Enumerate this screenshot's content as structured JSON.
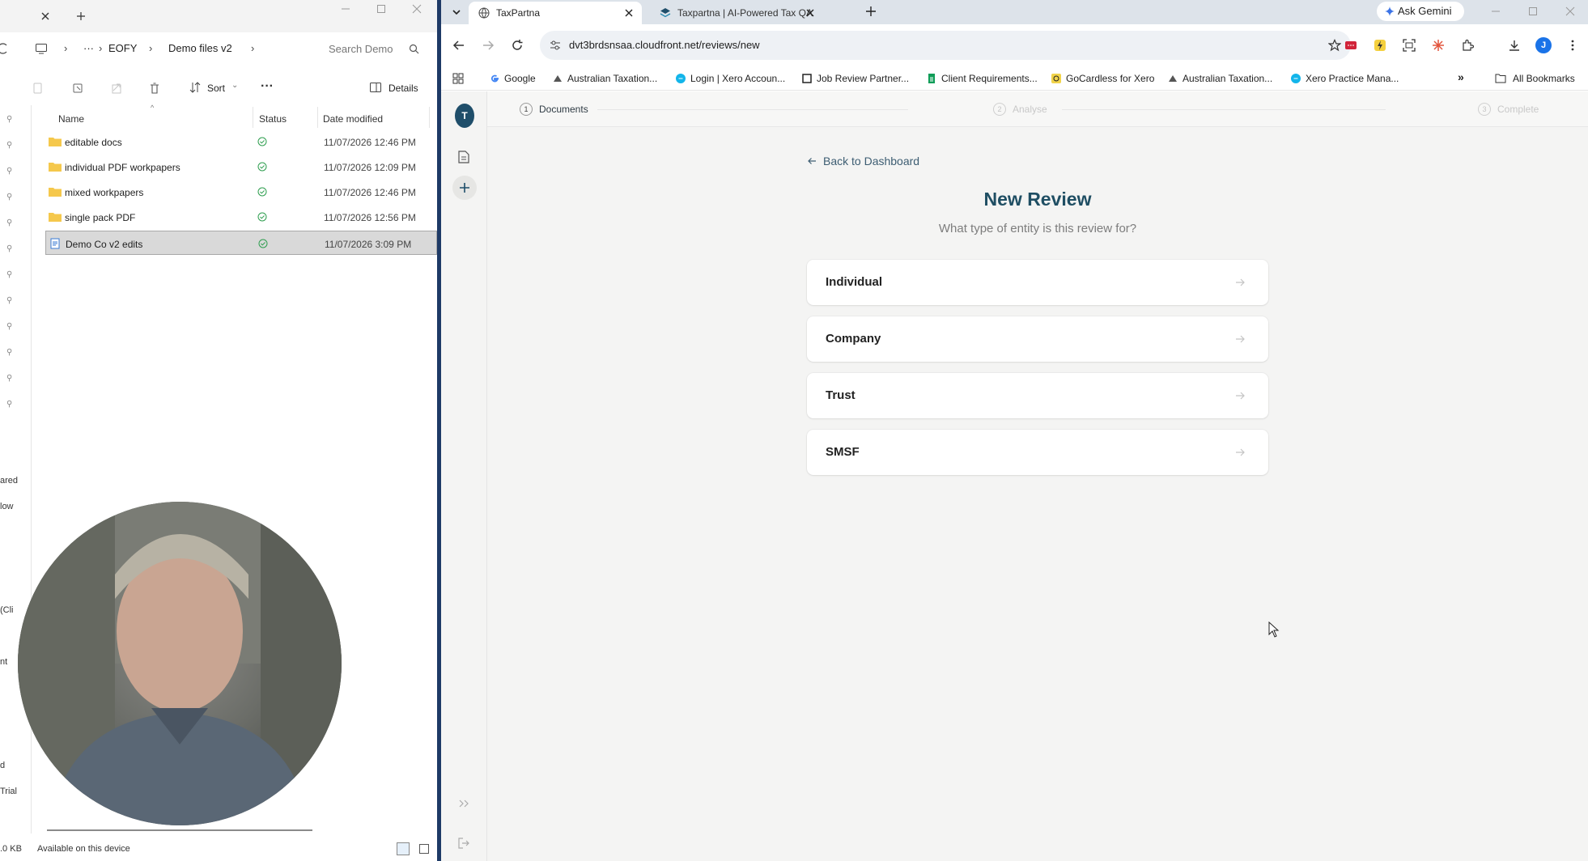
{
  "explorer": {
    "breadcrumb": [
      "EOFY",
      "Demo files v2"
    ],
    "more_crumbs": "···",
    "search_placeholder": "Search Demo",
    "sort_label": "Sort",
    "details_label": "Details",
    "columns": {
      "name": "Name",
      "status": "Status",
      "date": "Date modified"
    },
    "rows": [
      {
        "name": "editable docs",
        "type": "folder",
        "date": "11/07/2026 12:46 PM",
        "selected": false
      },
      {
        "name": "individual PDF workpapers",
        "type": "folder",
        "date": "11/07/2026 12:09 PM",
        "selected": false
      },
      {
        "name": "mixed workpapers",
        "type": "folder",
        "date": "11/07/2026 12:46 PM",
        "selected": false
      },
      {
        "name": "single pack PDF",
        "type": "folder",
        "date": "11/07/2026 12:56 PM",
        "selected": false
      },
      {
        "name": "Demo Co v2 edits",
        "type": "file",
        "date": "11/07/2026 3:09 PM",
        "selected": true
      }
    ],
    "side_fragments": [
      "ared",
      "low",
      "(Cli",
      "nt",
      "d",
      "Trial"
    ],
    "status_size": ".0 KB",
    "status_availability": "Available on this device",
    "folder_color": "#f5c84c",
    "status_ok_color": "#2e9e4f"
  },
  "chrome": {
    "tabs": [
      {
        "title": "TaxPartna",
        "active": true
      },
      {
        "title": "Taxpartna | AI-Powered Tax QA",
        "active": false
      }
    ],
    "gemini_label": "Ask Gemini",
    "url": "dvt3brdsnsaa.cloudfront.net/reviews/new",
    "bookmarks": [
      "Google",
      "Australian Taxation...",
      "Login | Xero Accoun...",
      "Job Review Partner...",
      "Client Requirements...",
      "GoCardless for Xero",
      "Australian Taxation...",
      "Xero Practice Mana..."
    ],
    "all_bookmarks": "All Bookmarks",
    "profile_initial": "J"
  },
  "app": {
    "avatar_initial": "T",
    "steps": [
      {
        "num": "1",
        "label": "Documents",
        "state": "active"
      },
      {
        "num": "2",
        "label": "Analyse",
        "state": "inactive"
      },
      {
        "num": "3",
        "label": "Complete",
        "state": "inactive"
      }
    ],
    "back_label": "Back to Dashboard",
    "title": "New Review",
    "subtitle": "What type of entity is this review for?",
    "entity_options": [
      "Individual",
      "Company",
      "Trust",
      "SMSF"
    ],
    "title_color": "#1f4e63",
    "accent_color": "#1f4e6a"
  }
}
